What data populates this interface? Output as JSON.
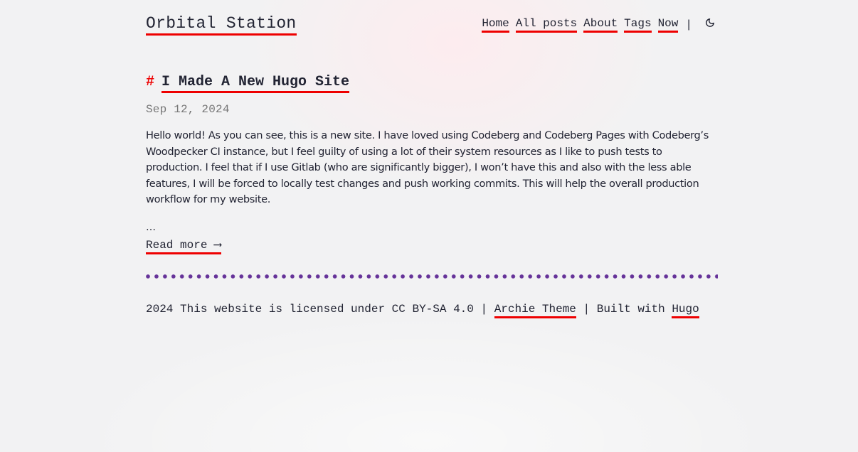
{
  "site": {
    "title": "Orbital Station",
    "accent_color": "#ee0000",
    "divider_color": "#663399"
  },
  "nav": {
    "items": [
      {
        "label": "Home"
      },
      {
        "label": "All posts"
      },
      {
        "label": "About"
      },
      {
        "label": "Tags"
      },
      {
        "label": "Now"
      }
    ],
    "separator": "|",
    "theme_toggle_icon": "moon-icon"
  },
  "post": {
    "hash": "#",
    "title": "I Made A New Hugo Site",
    "date": "Sep 12, 2024",
    "summary": "Hello world! As you can see, this is a new site. I have loved using Codeberg and Codeberg Pages with Codeberg’s Woodpecker CI instance, but I feel guilty of using a lot of their system resources as I like to push tests to production. I feel that if I use Gitlab (who are significantly bigger), I won’t have this and also with the less able features, I will be forced to locally test changes and push working commits. This will help the overall production workflow for my website.",
    "ellipsis": "…",
    "read_more": "Read more ⟶"
  },
  "footer": {
    "prefix": "2024 This website is licensed under CC BY-SA 4.0 | ",
    "theme_link": "Archie Theme",
    "middle": " | Built with ",
    "hugo_link": "Hugo"
  }
}
